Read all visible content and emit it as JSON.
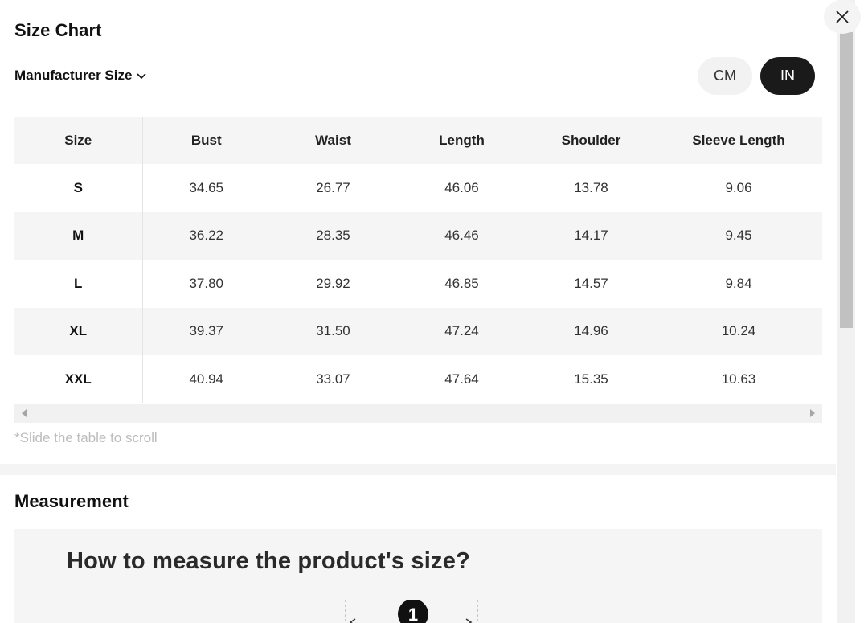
{
  "header": {
    "title": "Size Chart",
    "close_icon": "close-icon"
  },
  "size_selector": {
    "label": "Manufacturer Size",
    "icon": "chevron-down-icon"
  },
  "units": {
    "cm_label": "CM",
    "in_label": "IN",
    "selected": "IN"
  },
  "table": {
    "headers": [
      "Size",
      "Bust",
      "Waist",
      "Length",
      "Shoulder",
      "Sleeve Length"
    ],
    "rows": [
      [
        "S",
        "34.65",
        "26.77",
        "46.06",
        "13.78",
        "9.06"
      ],
      [
        "M",
        "36.22",
        "28.35",
        "46.46",
        "14.17",
        "9.45"
      ],
      [
        "L",
        "37.80",
        "29.92",
        "46.85",
        "14.57",
        "9.84"
      ],
      [
        "XL",
        "39.37",
        "31.50",
        "47.24",
        "14.96",
        "10.24"
      ],
      [
        "XXL",
        "40.94",
        "33.07",
        "47.64",
        "15.35",
        "10.63"
      ]
    ]
  },
  "scroll_hint": "*Slide the table to scroll",
  "measurement": {
    "title": "Measurement",
    "heading": "How to measure the product's size?",
    "step_badge": "1"
  },
  "colors": {
    "accent_dark": "#1a1a1a",
    "row_alt": "#f5f5f5",
    "hint_text": "#bcbcbc"
  }
}
